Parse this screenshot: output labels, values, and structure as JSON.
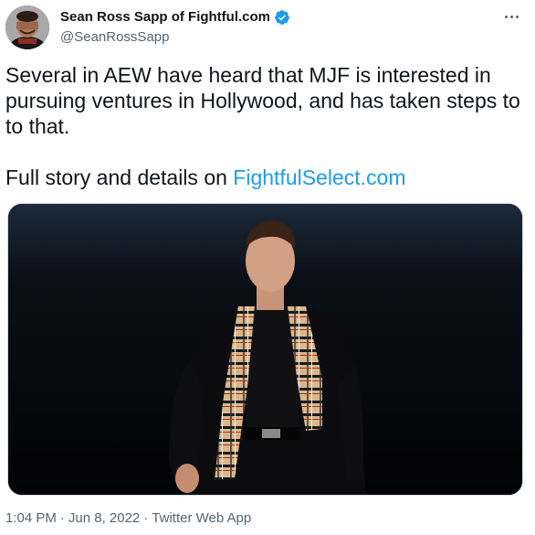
{
  "author": {
    "display_name": "Sean Ross Sapp of Fightful.com",
    "handle": "@SeanRossSapp",
    "verified": true,
    "verified_color": "#1d9bf0"
  },
  "tweet": {
    "text": "Several in AEW have heard that MJF is interested in pursuing ventures in Hollywood, and has taken steps to to that.",
    "story_prefix": "Full story and details on ",
    "story_link": "FightfulSelect.com"
  },
  "footer": {
    "time": "1:04 PM",
    "date": "Jun 8, 2022",
    "source": "Twitter Web App",
    "separator": "·"
  },
  "colors": {
    "text": "#0f1419",
    "secondary": "#536471",
    "link": "#1d9bf0"
  },
  "icons": {
    "more": "more-horizontal-icon",
    "verified": "verified-badge-icon"
  }
}
